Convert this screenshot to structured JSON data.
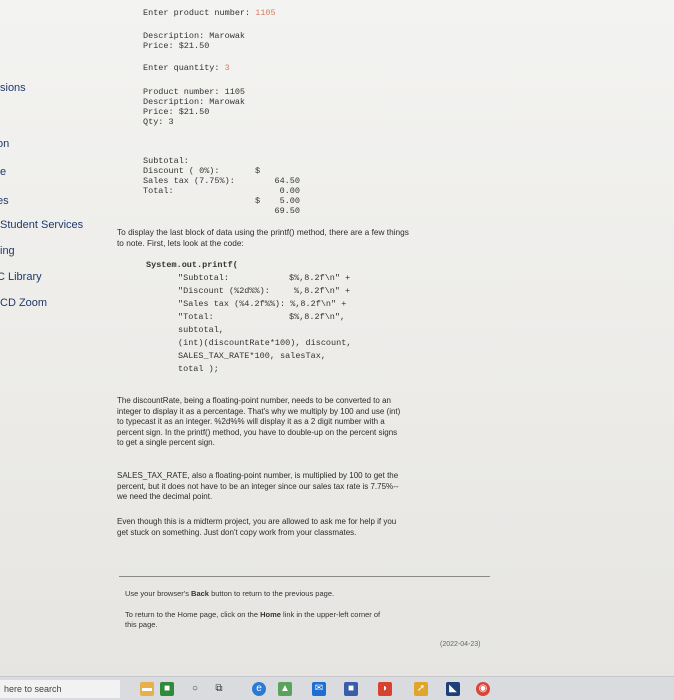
{
  "console": {
    "prompt_product": "Enter product number:",
    "product_input": "1105",
    "description": "Description: Marowak",
    "price": "Price: $21.50",
    "prompt_quantity": "Enter quantity:",
    "quantity_input": "3",
    "summary": {
      "product_number": "Product number: 1105",
      "description": "Description: Marowak",
      "price": "Price: $21.50",
      "qty": "Qty: 3"
    },
    "totals": [
      {
        "label": "Subtotal:",
        "currency": "$",
        "value": "64.50"
      },
      {
        "label": "Discount ( 0%):",
        "currency": "",
        "value": "0.00"
      },
      {
        "label": "Sales tax (7.75%):",
        "currency": "",
        "value": "5.00"
      },
      {
        "label": "Total:",
        "currency": "$",
        "value": "69.50"
      }
    ]
  },
  "sidebar": {
    "items": [
      {
        "label": "sions"
      },
      {
        "label": "on"
      },
      {
        "label": "e"
      },
      {
        "label": "es"
      },
      {
        "label": "Student Services"
      },
      {
        "label": "ing"
      },
      {
        "label": "C Library"
      },
      {
        "label": "CD Zoom"
      }
    ]
  },
  "intro": {
    "line1": "To display the last block of data using the printf() method, there are a few things",
    "line2": "to note. First, lets look at the code:"
  },
  "code": {
    "l1": "System.out.printf(",
    "l2a": "\"Subtotal:",
    "l2b": "$%,8.2f\\n\" +",
    "l3a": "\"Discount (%2d%%):",
    "l3b": "%,8.2f\\n\" +",
    "l4": "\"Sales tax (%4.2f%%): %,8.2f\\n\" +",
    "l5a": "\"Total:",
    "l5b": "$%,8.2f\\n\",",
    "l6": "subtotal,",
    "l7": "(int)(discountRate*100), discount,",
    "l8": "SALES_TAX_RATE*100, salesTax,",
    "l9": "total );"
  },
  "paragraphs": {
    "p1": [
      "The discountRate, being a floating-point number, needs to be converted to an",
      "integer to display it as a percentage. That's why we multiply by 100 and use (int)",
      "to typecast it as an integer. %2d%% will display it as a 2 digit number with a",
      "percent sign. In the printf() method, you have to double-up on the percent signs",
      "to get a single percent sign."
    ],
    "p2": [
      "SALES_TAX_RATE, also a floating-point number, is multiplied by 100 to get the",
      "percent, but it does not have to be an integer since our sales tax rate is 7.75%--",
      "we need the decimal point."
    ],
    "p3": [
      "Even though this is a midterm project, you are allowed to ask me for help if you",
      "get stuck on something. Just don't copy work from your classmates."
    ]
  },
  "footer": {
    "back_pre": "Use your browser's ",
    "back_bold": "Back",
    "back_post": " button to return to the previous page.",
    "home_pre": "To return to the Home page, click on the ",
    "home_bold": "Home",
    "home_post": " link in the upper-left corner of",
    "home_line2": "this page.",
    "date": "(2022-04-23)"
  },
  "taskbar": {
    "search_text": "here to search"
  }
}
